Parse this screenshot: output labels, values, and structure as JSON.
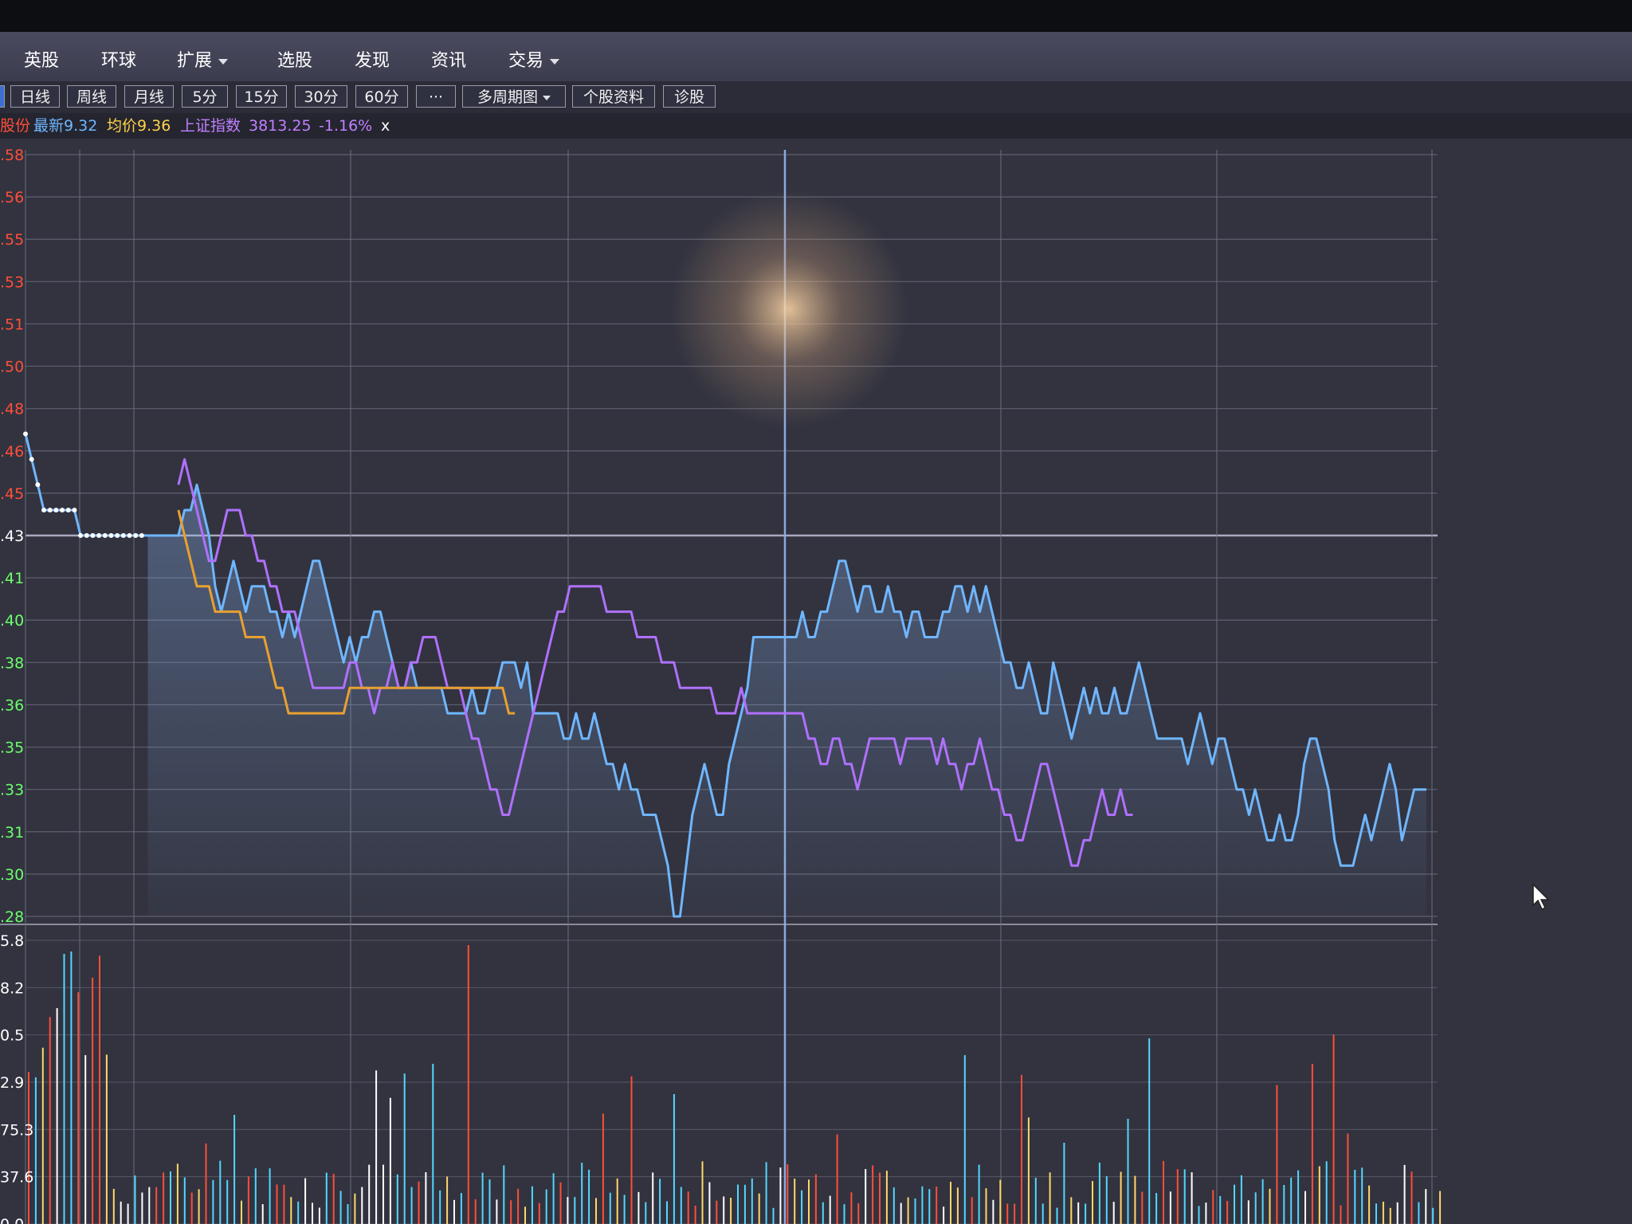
{
  "menu": {
    "items": [
      "英股",
      "环球",
      "扩展",
      "选股",
      "发现",
      "资讯",
      "交易"
    ],
    "has_dropdown": [
      false,
      false,
      true,
      false,
      false,
      false,
      true
    ]
  },
  "periods": {
    "buttons": [
      "日线",
      "周线",
      "月线",
      "5分",
      "15分",
      "30分",
      "60分",
      "···",
      "多周期图",
      "个股资料",
      "诊股"
    ],
    "dropdown": "多周期图",
    "tab_edge": "线"
  },
  "info": {
    "stock_name": "股份",
    "latest_label": "最新9.32",
    "avg_label": "均价9.36",
    "index_name": "上证指数",
    "index_value": "3813.25",
    "index_change": "-1.16%",
    "close": "x"
  },
  "colors": {
    "price": "#6fb6ff",
    "index": "#b070ff",
    "avg": "#e8a030",
    "up": "#ff4e3a",
    "down": "#52d8ff",
    "grid": "#6e7080"
  },
  "chart_data": {
    "type": "line",
    "price_axis_labels": [
      ".58",
      ".56",
      ".55",
      ".53",
      ".51",
      ".50",
      ".48",
      ".46",
      ".45",
      ".43",
      ".41",
      ".40",
      ".38",
      ".36",
      ".35",
      ".33",
      ".31",
      ".30",
      ".28"
    ],
    "price_axis_colors": [
      "up",
      "up",
      "up",
      "up",
      "up",
      "up",
      "up",
      "up",
      "up",
      "neutral",
      "down",
      "down",
      "down",
      "down",
      "down",
      "down",
      "down",
      "down",
      "down"
    ],
    "volume_axis_labels": [
      "5.8",
      "8.2",
      "0.5",
      "2.9",
      "75.3",
      "37.6",
      "0.0"
    ],
    "ylim": [
      9.28,
      9.58
    ],
    "reference_price": 9.43,
    "series": [
      {
        "key": "price",
        "values": [
          9.47,
          9.46,
          9.45,
          9.44,
          9.44,
          9.44,
          9.44,
          9.44,
          9.44,
          9.43,
          9.43,
          9.43,
          9.43,
          9.43,
          9.43,
          9.43,
          9.43,
          9.43,
          9.43,
          9.43,
          9.43,
          9.43,
          9.43,
          9.43,
          9.43,
          9.43,
          9.44,
          9.44,
          9.45,
          9.44,
          9.43,
          9.41,
          9.4,
          9.41,
          9.42,
          9.41,
          9.4,
          9.41,
          9.41,
          9.41,
          9.4,
          9.4,
          9.39,
          9.4,
          9.39,
          9.4,
          9.41,
          9.42,
          9.42,
          9.41,
          9.4,
          9.39,
          9.38,
          9.39,
          9.38,
          9.39,
          9.39,
          9.4,
          9.4,
          9.39,
          9.38,
          9.37,
          9.37,
          9.38,
          9.37,
          9.37,
          9.37,
          9.37,
          9.37,
          9.36,
          9.36,
          9.36,
          9.36,
          9.37,
          9.36,
          9.36,
          9.37,
          9.37,
          9.38,
          9.38,
          9.38,
          9.37,
          9.38,
          9.36,
          9.36,
          9.36,
          9.36,
          9.36,
          9.35,
          9.35,
          9.36,
          9.35,
          9.35,
          9.36,
          9.35,
          9.34,
          9.34,
          9.33,
          9.34,
          9.33,
          9.33,
          9.32,
          9.32,
          9.32,
          9.31,
          9.3,
          9.28,
          9.28,
          9.3,
          9.32,
          9.33,
          9.34,
          9.33,
          9.32,
          9.32,
          9.34,
          9.35,
          9.36,
          9.37,
          9.39,
          9.39,
          9.39,
          9.39,
          9.39,
          9.39,
          9.39,
          9.39,
          9.4,
          9.39,
          9.39,
          9.4,
          9.4,
          9.41,
          9.42,
          9.42,
          9.41,
          9.4,
          9.41,
          9.41,
          9.4,
          9.4,
          9.41,
          9.4,
          9.4,
          9.39,
          9.4,
          9.4,
          9.39,
          9.39,
          9.39,
          9.4,
          9.4,
          9.41,
          9.41,
          9.4,
          9.41,
          9.4,
          9.41,
          9.4,
          9.39,
          9.38,
          9.38,
          9.37,
          9.37,
          9.38,
          9.37,
          9.36,
          9.36,
          9.38,
          9.37,
          9.36,
          9.35,
          9.36,
          9.37,
          9.36,
          9.37,
          9.36,
          9.36,
          9.37,
          9.36,
          9.36,
          9.37,
          9.38,
          9.37,
          9.36,
          9.35,
          9.35,
          9.35,
          9.35,
          9.35,
          9.34,
          9.35,
          9.36,
          9.35,
          9.34,
          9.35,
          9.35,
          9.34,
          9.33,
          9.33,
          9.32,
          9.33,
          9.32,
          9.31,
          9.31,
          9.32,
          9.31,
          9.31,
          9.32,
          9.34,
          9.35,
          9.35,
          9.34,
          9.33,
          9.31,
          9.3,
          9.3,
          9.3,
          9.31,
          9.32,
          9.31,
          9.32,
          9.33,
          9.34,
          9.33,
          9.31,
          9.32,
          9.33,
          9.33,
          9.33
        ],
        "start_index": 0,
        "pre_open_points": 20
      },
      {
        "key": "index",
        "values": [
          9.45,
          9.46,
          9.45,
          9.44,
          9.43,
          9.42,
          9.42,
          9.43,
          9.44,
          9.44,
          9.44,
          9.43,
          9.43,
          9.42,
          9.42,
          9.41,
          9.41,
          9.4,
          9.4,
          9.4,
          9.39,
          9.38,
          9.37,
          9.37,
          9.37,
          9.37,
          9.37,
          9.37,
          9.38,
          9.38,
          9.37,
          9.37,
          9.36,
          9.37,
          9.37,
          9.38,
          9.37,
          9.37,
          9.38,
          9.38,
          9.39,
          9.39,
          9.39,
          9.38,
          9.37,
          9.37,
          9.37,
          9.36,
          9.35,
          9.35,
          9.34,
          9.33,
          9.33,
          9.32,
          9.32,
          9.33,
          9.34,
          9.35,
          9.36,
          9.37,
          9.38,
          9.39,
          9.4,
          9.4,
          9.41,
          9.41,
          9.41,
          9.41,
          9.41,
          9.41,
          9.4,
          9.4,
          9.4,
          9.4,
          9.4,
          9.39,
          9.39,
          9.39,
          9.39,
          9.38,
          9.38,
          9.38,
          9.37,
          9.37,
          9.37,
          9.37,
          9.37,
          9.37,
          9.36,
          9.36,
          9.36,
          9.36,
          9.37,
          9.36,
          9.36,
          9.36,
          9.36,
          9.36,
          9.36,
          9.36,
          9.36,
          9.36,
          9.36,
          9.35,
          9.35,
          9.34,
          9.34,
          9.35,
          9.35,
          9.34,
          9.34,
          9.33,
          9.34,
          9.35,
          9.35,
          9.35,
          9.35,
          9.35,
          9.34,
          9.35,
          9.35,
          9.35,
          9.35,
          9.35,
          9.34,
          9.35,
          9.34,
          9.34,
          9.33,
          9.34,
          9.34,
          9.35,
          9.34,
          9.33,
          9.33,
          9.32,
          9.32,
          9.31,
          9.31,
          9.32,
          9.33,
          9.34,
          9.34,
          9.33,
          9.32,
          9.31,
          9.3,
          9.3,
          9.31,
          9.31,
          9.32,
          9.33,
          9.32,
          9.32,
          9.33,
          9.32,
          9.32
        ],
        "start_index": 25
      },
      {
        "key": "avg",
        "values": [
          9.44,
          9.43,
          9.42,
          9.41,
          9.41,
          9.41,
          9.4,
          9.4,
          9.4,
          9.4,
          9.4,
          9.39,
          9.39,
          9.39,
          9.39,
          9.38,
          9.37,
          9.37,
          9.36,
          9.36,
          9.36,
          9.36,
          9.36,
          9.36,
          9.36,
          9.36,
          9.36,
          9.36,
          9.37,
          9.37,
          9.37,
          9.37,
          9.37,
          9.37,
          9.37,
          9.37,
          9.37,
          9.37,
          9.37,
          9.37,
          9.37,
          9.37,
          9.37,
          9.37,
          9.37,
          9.37,
          9.37,
          9.37,
          9.37,
          9.37,
          9.37,
          9.37,
          9.37,
          9.37,
          9.36,
          9.36
        ],
        "start_index": 25
      }
    ]
  }
}
